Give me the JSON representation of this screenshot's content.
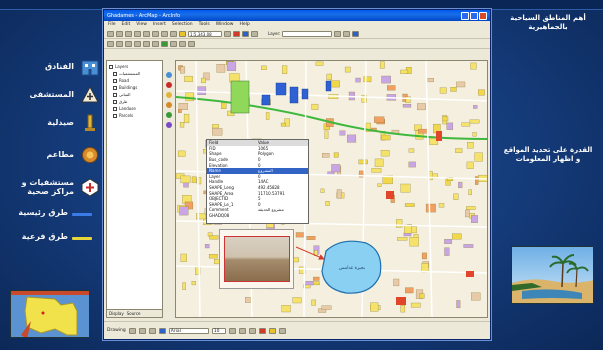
{
  "slide": {
    "legend": [
      {
        "id": "hotels",
        "label": "الفنادق",
        "icon": "hotel-icon",
        "color": "#4a8fd4"
      },
      {
        "id": "hospitals",
        "label": "المستشفى",
        "icon": "hospital-icon",
        "color": "#f2ecd6"
      },
      {
        "id": "pharmacy",
        "label": "صيدلية",
        "icon": "pharmacy-icon",
        "color": "#e3b43a"
      },
      {
        "id": "restaurants",
        "label": "مطاعم",
        "icon": "restaurant-icon",
        "color": "#d88a2a"
      },
      {
        "id": "clinics",
        "label": "مستشفيات و مراكز صحية",
        "icon": "clinic-icon",
        "color": "#ffffff"
      },
      {
        "id": "main-road",
        "label": "طرق رئيسية",
        "swatch": "#3a7be8"
      },
      {
        "id": "sub-road",
        "label": "طرق فرعية",
        "swatch": "#e6d63a"
      }
    ],
    "right_top_text": "أهم المناطق السياحية بالجماهيرية",
    "right_mid_text": "القدرة على تحديد المواقع و اظهار المعلومات"
  },
  "app": {
    "title": "Ghadames - ArcMap - ArcInfo",
    "menu": [
      "File",
      "Edit",
      "View",
      "Insert",
      "Selection",
      "Tools",
      "Window",
      "Help"
    ],
    "scale": "1:5,343.08",
    "layer_field": "Layer:",
    "toc": {
      "tab_display": "Display",
      "tab_source": "Source",
      "items": [
        "Layers",
        "المستشفيات",
        "Road",
        "Buildings",
        "المباني",
        "طرق",
        "Landuse",
        "Parcels"
      ]
    },
    "identify": {
      "header": [
        "Field",
        "Value"
      ],
      "rows": [
        [
          "FID",
          "1065"
        ],
        [
          "Shape",
          "Polygon"
        ],
        [
          "Bus_code",
          "0"
        ],
        [
          "Elevation",
          "0"
        ],
        [
          "Name",
          "المشروع"
        ],
        [
          "Layer",
          "0"
        ],
        [
          "Handle",
          "14AC"
        ],
        [
          "SHAPE_Leng",
          "492.45828"
        ],
        [
          "SHAPE_Area",
          "11710.53791"
        ],
        [
          "OBJECTID",
          "5"
        ],
        [
          "SHAPE_Le_1",
          "0"
        ],
        [
          "Comment",
          "مشروع الحديقة"
        ],
        [
          "GHADQ08",
          ""
        ]
      ],
      "selected_row": 4
    },
    "map_label": "بحيرة غدامس",
    "status": {
      "drawing": "Drawing",
      "font": "Arial",
      "font_size": "10"
    }
  }
}
